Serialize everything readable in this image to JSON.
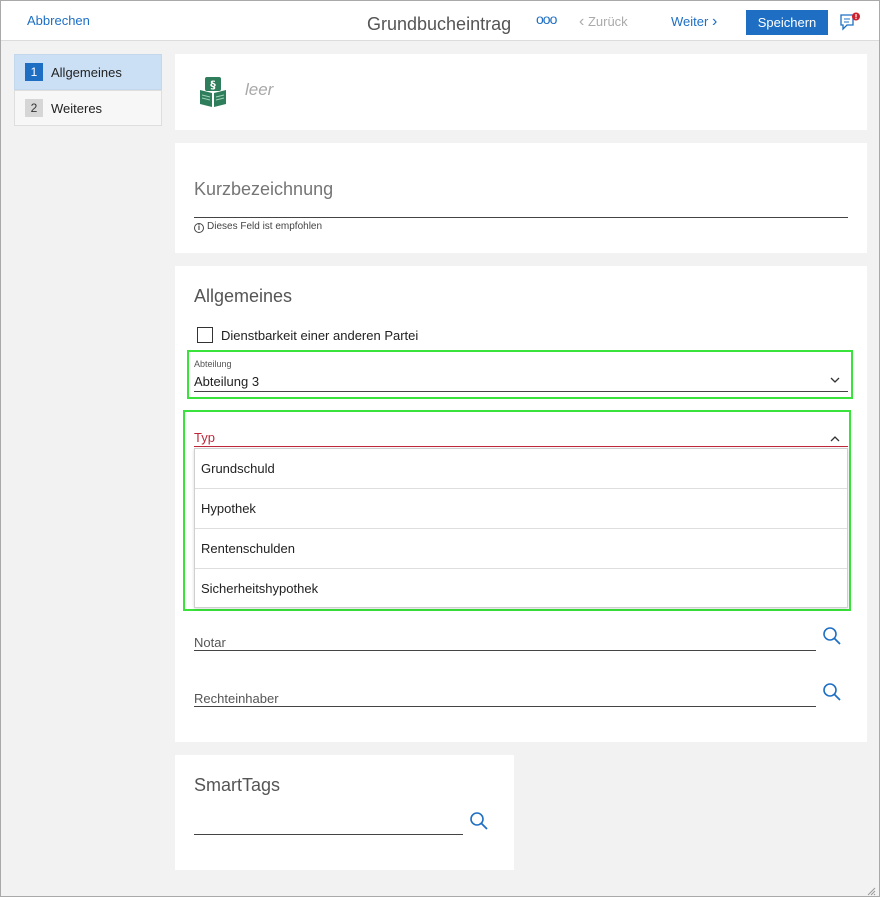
{
  "topbar": {
    "cancel_label": "Abbrechen",
    "title": "Grundbucheintrag",
    "more_label": "ooo",
    "back_label": "Zurück",
    "next_label": "Weiter",
    "save_label": "Speichern",
    "notification_icon": "chat-alert-icon"
  },
  "sidebar": {
    "items": [
      {
        "number": "1",
        "label": "Allgemeines",
        "active": true
      },
      {
        "number": "2",
        "label": "Weiteres",
        "active": false
      }
    ]
  },
  "header_card": {
    "icon": "land-register-book-icon",
    "name_placeholder": "leer"
  },
  "kurz": {
    "placeholder": "Kurzbezeichnung",
    "hint": "Dieses Feld ist empfohlen"
  },
  "allgemeines": {
    "title": "Allgemeines",
    "checkbox_label": "Dienstbarkeit einer anderen Partei",
    "abteilung": {
      "label": "Abteilung",
      "value": "Abteilung 3"
    },
    "typ": {
      "label": "Typ",
      "options": [
        "Grundschuld",
        "Hypothek",
        "Rentenschulden",
        "Sicherheitshypothek"
      ]
    },
    "notar_placeholder": "Notar",
    "rechteinhaber_placeholder": "Rechteinhaber"
  },
  "smarttags": {
    "title": "SmartTags"
  },
  "colors": {
    "accent": "#1e6fc4",
    "error": "#c0283a",
    "highlight": "#39e33c"
  }
}
